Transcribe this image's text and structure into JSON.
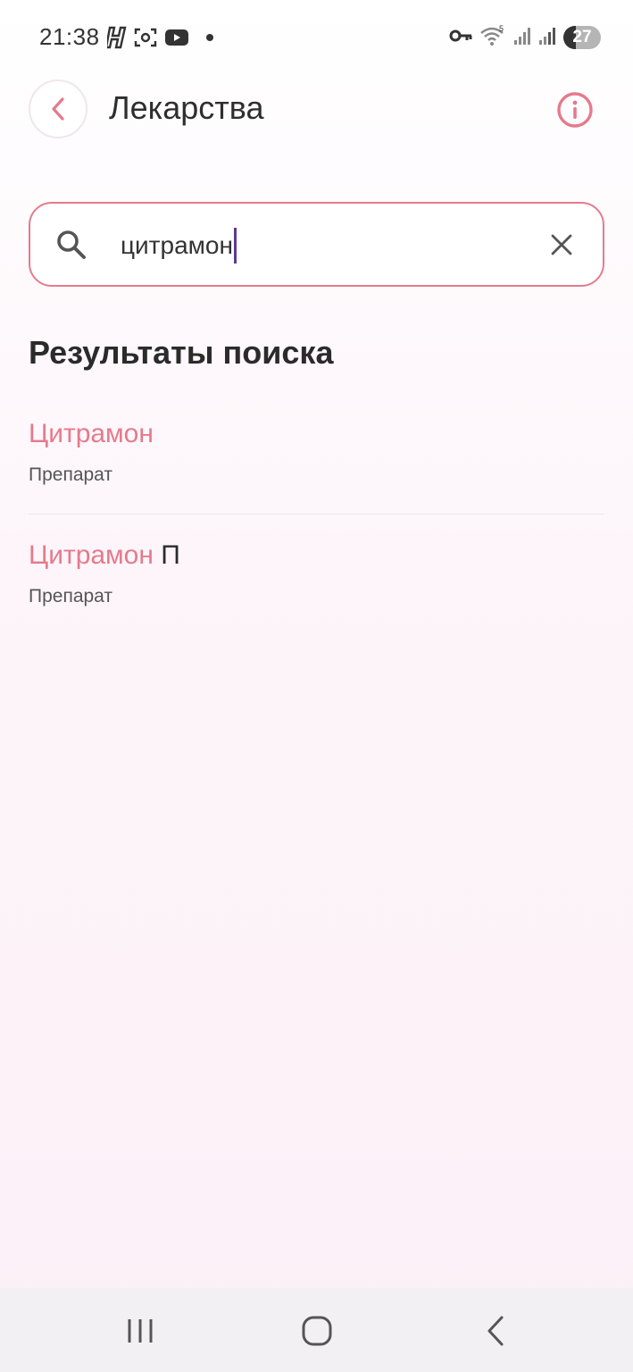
{
  "status_bar": {
    "time": "21:38",
    "battery": "27",
    "left_icons": [
      "h-app-icon",
      "screenshot-icon",
      "youtube-icon",
      "dot-icon"
    ],
    "right_icons": [
      "vpn-key-icon",
      "wifi-icon",
      "signal-icon",
      "signal-icon",
      "battery-icon"
    ]
  },
  "header": {
    "title": "Лекарства",
    "accent_color": "#e57a8c"
  },
  "search": {
    "value": "цитрамон"
  },
  "results": {
    "heading": "Результаты поиска",
    "items": [
      {
        "title_highlight": "Цитрамон",
        "title_rest": "",
        "subtitle": "Препарат"
      },
      {
        "title_highlight": "Цитрамон",
        "title_rest": " П",
        "subtitle": "Препарат"
      }
    ]
  },
  "nav_bar": {
    "buttons": [
      "recent-apps-icon",
      "home-icon",
      "back-icon"
    ]
  }
}
